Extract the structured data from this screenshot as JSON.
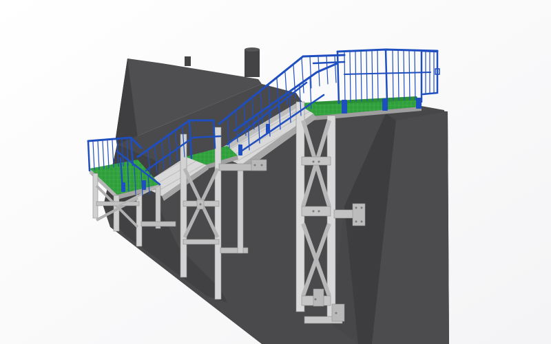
{
  "scene": {
    "colors": {
      "background": "#ffffff",
      "wall_side": "#4a4a4c",
      "wall_top": "#5b5b5e",
      "wall_dark": "#3c3c3e",
      "steel": "#c9c9c9",
      "steel_light": "#e2e2e2",
      "steel_dark": "#9e9e9e",
      "grating": "#2f9e3c",
      "grating_light": "#49b34f",
      "railing": "#1f4ebf",
      "railing_dark": "#163a93",
      "stair": "#d6d6d6"
    }
  }
}
